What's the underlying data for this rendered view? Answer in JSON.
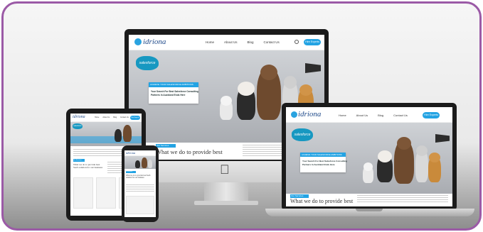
{
  "site": {
    "brand": "idriona",
    "nav": [
      "Home",
      "About Us",
      "Blog",
      "Contact Us"
    ],
    "cta": "Hire Experts",
    "salesforce_logo": "salesforce",
    "hero_card_header": "ACHIEVE YOUR SALESFORCE AMBITIONS",
    "hero_card_lines": [
      "Your Search For Best Salesforce Consulting",
      "Partners In Auckland Ends Here"
    ],
    "section_tag": "Our Services",
    "section_title": "What we do to provide best",
    "tablet_section_title": "What we do to provide best SaaS solution for our business"
  },
  "colors": {
    "frame_border": "#9b5aa6",
    "accent": "#23a3e3",
    "salesforce_blue": "#1798c1",
    "brand_blue": "#1f4a8a"
  },
  "icons": {
    "apple_logo": "apple-logo-icon",
    "search": "search-icon",
    "partner_badge": "partner-badge-icon"
  }
}
